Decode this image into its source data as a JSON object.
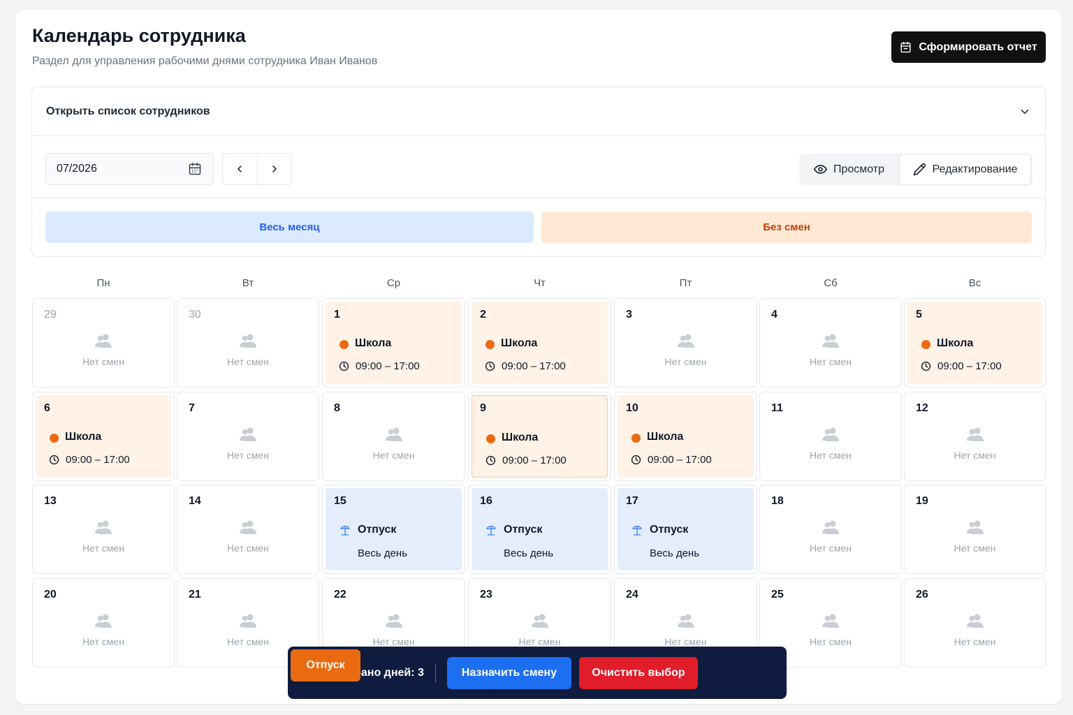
{
  "header": {
    "title": "Календарь сотрудника",
    "subtitle": "Раздел для управления рабочими днями сотрудника Иван Иванов",
    "report_button": "Сформировать отчет"
  },
  "employee_selector": {
    "label": "Открыть список сотрудников"
  },
  "toolbar": {
    "month_value": "07/2026",
    "mode_view": "Просмотр",
    "mode_edit": "Редактирование",
    "active_mode": "Редактирование"
  },
  "filters": {
    "all_month": "Весь месяц",
    "no_shifts": "Без смен"
  },
  "weekdays": [
    "Пн",
    "Вт",
    "Ср",
    "Чт",
    "Пт",
    "Сб",
    "Вс"
  ],
  "calendar": {
    "empty_label": "Нет смен",
    "days": [
      {
        "day": "29",
        "other_month": true,
        "type": "empty"
      },
      {
        "day": "30",
        "other_month": true,
        "type": "empty"
      },
      {
        "day": "1",
        "type": "shift",
        "name": "Школа",
        "time": "09:00 – 17:00"
      },
      {
        "day": "2",
        "type": "shift",
        "name": "Школа",
        "time": "09:00 – 17:00"
      },
      {
        "day": "3",
        "type": "empty"
      },
      {
        "day": "4",
        "type": "empty"
      },
      {
        "day": "5",
        "type": "shift",
        "name": "Школа",
        "time": "09:00 – 17:00"
      },
      {
        "day": "6",
        "type": "shift",
        "name": "Школа",
        "time": "09:00 – 17:00"
      },
      {
        "day": "7",
        "type": "empty"
      },
      {
        "day": "8",
        "type": "empty"
      },
      {
        "day": "9",
        "type": "shift",
        "name": "Школа",
        "time": "09:00 – 17:00",
        "highlighted": true
      },
      {
        "day": "10",
        "type": "shift",
        "name": "Школа",
        "time": "09:00 – 17:00"
      },
      {
        "day": "11",
        "type": "empty"
      },
      {
        "day": "12",
        "type": "empty"
      },
      {
        "day": "13",
        "type": "empty"
      },
      {
        "day": "14",
        "type": "empty"
      },
      {
        "day": "15",
        "type": "vacation",
        "name": "Отпуск",
        "sub": "Весь день"
      },
      {
        "day": "16",
        "type": "vacation",
        "name": "Отпуск",
        "sub": "Весь день"
      },
      {
        "day": "17",
        "type": "vacation",
        "name": "Отпуск",
        "sub": "Весь день"
      },
      {
        "day": "18",
        "type": "empty"
      },
      {
        "day": "19",
        "type": "empty"
      },
      {
        "day": "20",
        "type": "empty"
      },
      {
        "day": "21",
        "type": "empty"
      },
      {
        "day": "22",
        "type": "empty"
      },
      {
        "day": "23",
        "type": "empty"
      },
      {
        "day": "24",
        "type": "empty"
      },
      {
        "day": "25",
        "type": "empty"
      },
      {
        "day": "26",
        "type": "empty"
      }
    ]
  },
  "selection_bar": {
    "label": "Выбрано дней: 3",
    "assign_button": "Назначить смену",
    "vacation_button": "Отпуск",
    "clear_button": "Очистить выбор"
  },
  "colors": {
    "accent_blue": "#1d6ff2",
    "shift_orange": "#ea6a12",
    "danger_red": "#e11d2a",
    "bar_navy": "#0f1c3f"
  },
  "icons": {
    "report": "calendar-icon",
    "selector": "chevron-down-icon",
    "date_input": "calendar-icon",
    "prev": "chevron-left-icon",
    "next": "chevron-right-icon",
    "view": "eye-icon",
    "edit": "pencil-icon",
    "empty_day": "users-icon",
    "shift_time": "clock-icon",
    "vacation": "umbrella-beach-icon"
  }
}
